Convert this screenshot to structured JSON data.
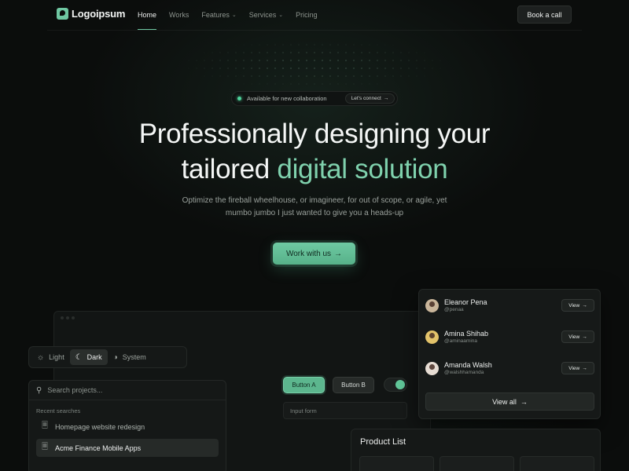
{
  "nav": {
    "brand": "Logoipsum",
    "links": [
      {
        "label": "Home",
        "active": true,
        "dropdown": false
      },
      {
        "label": "Works",
        "active": false,
        "dropdown": false
      },
      {
        "label": "Features",
        "active": false,
        "dropdown": true
      },
      {
        "label": "Services",
        "active": false,
        "dropdown": true
      },
      {
        "label": "Pricing",
        "active": false,
        "dropdown": false
      }
    ],
    "cta_label": "Book a call"
  },
  "hero": {
    "badge_text": "Available for new collaboration",
    "badge_button": "Let's connect",
    "title_line1": "Professionally designing your",
    "title_line2_plain": "tailored ",
    "title_line2_accent": "digital solution",
    "subtitle": "Optimize the fireball wheelhouse, or imagineer, for out of scope, or agile, yet mumbo jumbo I just wanted to give you a heads-up",
    "cta_label": "Work with us"
  },
  "theme_switcher": {
    "options": [
      {
        "label": "Light",
        "icon": "sun-icon",
        "selected": false
      },
      {
        "label": "Dark",
        "icon": "moon-icon",
        "selected": true
      },
      {
        "label": "System",
        "icon": "system-icon",
        "selected": false
      }
    ]
  },
  "search": {
    "placeholder": "Search projects...",
    "recent_label": "Recent searches",
    "recent": [
      {
        "label": "Homepage website redesign",
        "selected": false
      },
      {
        "label": "Acme Finance Mobile Apps",
        "selected": true
      }
    ]
  },
  "controls": {
    "button_a": "Button A",
    "button_b": "Button B",
    "toggle_on": true,
    "input_placeholder": "Input form"
  },
  "users": {
    "list": [
      {
        "name": "Eleanor Pena",
        "handle": "@penaa",
        "view": "View",
        "avatar_color": "#c9b59a"
      },
      {
        "name": "Amina Shihab",
        "handle": "@aminaamina",
        "view": "View",
        "avatar_color": "#e3c36a"
      },
      {
        "name": "Amanda Walsh",
        "handle": "@walshhamanda",
        "view": "View",
        "avatar_color": "#e6dcd3"
      }
    ],
    "view_all": "View all"
  },
  "products": {
    "title": "Product List"
  },
  "colors": {
    "accent": "#6fc7a2",
    "background": "#0b0d0c",
    "status_dot": "#4fd49c"
  }
}
